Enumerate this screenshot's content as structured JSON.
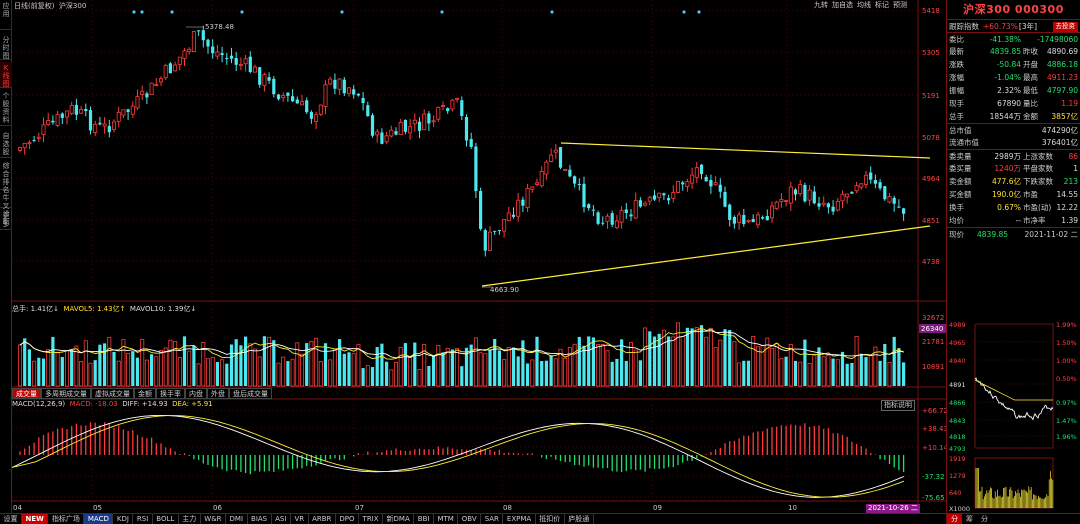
{
  "left_sidebar": [
    "应用",
    "分时图",
    "K线图",
    "个股资料",
    "自选股",
    "综合排名",
    "牛叉诊断",
    "更多"
  ],
  "top_info": {
    "period": "日线(前复权)",
    "name": "沪深300"
  },
  "top_tools": [
    "九转",
    "加自选",
    "均线",
    "标记",
    "预测"
  ],
  "price_axis": [
    "5418",
    "5305",
    "5191",
    "5078",
    "4964",
    "4851",
    "4738"
  ],
  "high_label": "5378.48",
  "low_label": "4663.90",
  "volume_header": {
    "total": "总手: 1.41亿↓",
    "ma5": "MAVOL5: 1.43亿↑",
    "ma10": "MAVOL10: 1.39亿↓"
  },
  "volume_axis": [
    "32672",
    "21781",
    "10891"
  ],
  "volume_current": "26340",
  "tabs1": [
    "成交量",
    "多周期成交量",
    "虚拟成交量",
    "金额",
    "换手率",
    "内盘",
    "外盘",
    "盘后成交量"
  ],
  "macd_header": {
    "label": "MACD(12,26,9)",
    "macd": "MACD: -18.03",
    "diff": "DIFF: +14.93",
    "dea": "DEA: +5.91"
  },
  "macd_button": "指标说明",
  "macd_axis": [
    "+66.72",
    "+38.43",
    "+10.14",
    "-37.32",
    "-75.65"
  ],
  "month_labels": [
    "04",
    "05",
    "06",
    "07",
    "08",
    "09",
    "10"
  ],
  "date_label": "2021-10-26 二",
  "bottom_tabs": [
    "设置",
    "NEW",
    "指标广场",
    "MACD",
    "KDJ",
    "RSI",
    "BOLL",
    "主力",
    "W&R",
    "DMI",
    "BIAS",
    "ASI",
    "VR",
    "ARBR",
    "DPO",
    "TRIX",
    "新DMA",
    "BBI",
    "MTM",
    "OBV",
    "SAR",
    "EXPMA",
    "抵扣价",
    "庐股通"
  ],
  "right": {
    "title": "沪深300 000300",
    "track_label": "跟踪指数",
    "track_value": "+60.73%",
    "track_period": "[3年]",
    "track_btn": "去投资",
    "rows": [
      {
        "l": "委比",
        "v": "-41.38%",
        "l2": "",
        "v2": "-17498060",
        "c": "g",
        "c2": "g"
      },
      {
        "l": "最新",
        "v": "4839.85",
        "l2": "昨收",
        "v2": "4890.69",
        "c": "g",
        "c2": "w"
      },
      {
        "l": "涨跌",
        "v": "-50.84",
        "l2": "开盘",
        "v2": "4886.18",
        "c": "g",
        "c2": "g"
      },
      {
        "l": "涨幅",
        "v": "-1.04%",
        "l2": "最高",
        "v2": "4911.23",
        "c": "g",
        "c2": "r"
      },
      {
        "l": "振幅",
        "v": "2.32%",
        "l2": "最低",
        "v2": "4797.90",
        "c": "w",
        "c2": "g"
      },
      {
        "l": "现手",
        "v": "67890",
        "l2": "量比",
        "v2": "1.19",
        "c": "w",
        "c2": "r"
      },
      {
        "l": "总手",
        "v": "18544万",
        "l2": "金额",
        "v2": "3857亿",
        "c": "w",
        "c2": "y"
      }
    ],
    "rows2": [
      {
        "l": "总市值",
        "v": "474290亿",
        "c": "w"
      },
      {
        "l": "流通市值",
        "v": "376401亿",
        "c": "w"
      }
    ],
    "rows3": [
      {
        "l": "委卖量",
        "v": "2989万",
        "l2": "上涨家数",
        "v2": "86",
        "c": "w",
        "c2": "r"
      },
      {
        "l": "委买量",
        "v": "1240万",
        "l2": "平盘家数",
        "v2": "1",
        "c": "r",
        "c2": "w"
      },
      {
        "l": "卖金额",
        "v": "477.6亿",
        "l2": "下跌家数",
        "v2": "213",
        "c": "y",
        "c2": "g"
      },
      {
        "l": "买金额",
        "v": "190.0亿",
        "l2": "市盈",
        "v2": "14.55",
        "c": "y",
        "c2": "w"
      },
      {
        "l": "换手",
        "v": "0.67%",
        "l2": "市盈(动)",
        "v2": "12.22",
        "c": "y",
        "c2": "w"
      },
      {
        "l": "均价",
        "v": "--",
        "l2": "市净率",
        "v2": "1.39",
        "c": "w",
        "c2": "w"
      }
    ],
    "now_label": "现价",
    "now_value": "4839.85",
    "now_date": "2021-11-02 二",
    "mini_left": [
      "4989",
      "4965",
      "4940",
      "4891",
      "4866",
      "4843",
      "4818",
      "4793"
    ],
    "mini_right": [
      "1.99%",
      "1.50%",
      "1.00%",
      "0.50%",
      "0.97%",
      "1.47%",
      "1.96%"
    ],
    "mini_vol": [
      "1919",
      "1279",
      "640",
      "X1000"
    ],
    "rbottom": [
      "分",
      "筹",
      "分"
    ]
  }
}
